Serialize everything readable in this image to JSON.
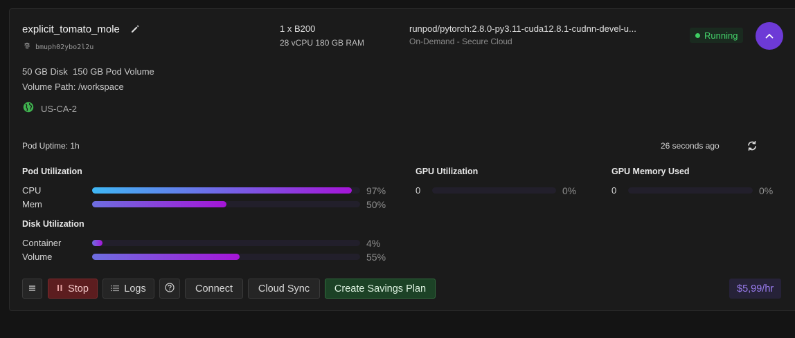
{
  "pod": {
    "name": "explicit_tomato_mole",
    "id": "bmuph02ybo2l2u",
    "gpu": "1 x B200",
    "specs": "28 vCPU 180 GB RAM",
    "image": "runpod/pytorch:2.8.0-py3.11-cuda12.8.1-cudnn-devel-u...",
    "cloud": "On-Demand - Secure Cloud",
    "status": "Running",
    "disk": "50 GB Disk",
    "pod_volume": "150 GB Pod Volume",
    "volume_path": "Volume Path: /workspace",
    "region": "US-CA-2"
  },
  "uptime": {
    "label": "Pod Uptime: 1h",
    "updated": "26 seconds ago"
  },
  "pod_utilization": {
    "title": "Pod Utilization",
    "rows": [
      {
        "label": "CPU",
        "percent": 97,
        "display": "97%"
      },
      {
        "label": "Mem",
        "percent": 50,
        "display": "50%"
      }
    ]
  },
  "disk_utilization": {
    "title": "Disk Utilization",
    "rows": [
      {
        "label": "Container",
        "percent": 4,
        "display": "4%"
      },
      {
        "label": "Volume",
        "percent": 55,
        "display": "55%"
      }
    ]
  },
  "gpu_utilization": {
    "title": "GPU Utilization",
    "rows": [
      {
        "label": "0",
        "percent": 0,
        "display": "0%"
      }
    ]
  },
  "gpu_memory": {
    "title": "GPU Memory Used",
    "rows": [
      {
        "label": "0",
        "percent": 0,
        "display": "0%"
      }
    ]
  },
  "actions": {
    "stop": "Stop",
    "logs": "Logs",
    "connect": "Connect",
    "cloud_sync": "Cloud Sync",
    "savings": "Create Savings Plan"
  },
  "price": "$5,99/hr",
  "colors": {
    "accent": "#6d3ad6",
    "running": "#3ecf62",
    "cpu_gradient": [
      "#3fb8f5",
      "#a515d8"
    ],
    "bar_gradient": [
      "#6d6ee0",
      "#a515d8"
    ]
  },
  "icons": {
    "edit": "pencil-icon",
    "fingerprint": "fingerprint-icon",
    "globe": "globe-icon",
    "collapse": "chevron-up-icon",
    "refresh": "refresh-icon",
    "menu": "menu-icon",
    "stop": "pause-icon",
    "logs": "list-icon",
    "help": "help-icon"
  }
}
